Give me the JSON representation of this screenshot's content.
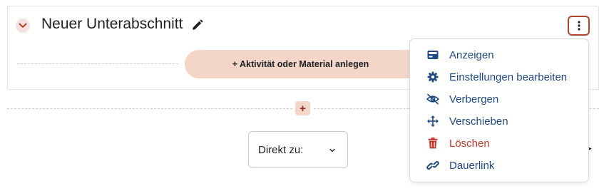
{
  "section": {
    "title": "Neuer Unterabschnitt",
    "add_activity_label": "+ Aktivität oder Material anlegen",
    "add_section_label": "+"
  },
  "jump": {
    "label": "Direkt zu:"
  },
  "menu": {
    "items": [
      {
        "label": "Anzeigen",
        "icon": "show-icon"
      },
      {
        "label": "Einstellungen bearbeiten",
        "icon": "gear-icon"
      },
      {
        "label": "Verbergen",
        "icon": "eye-slash-icon"
      },
      {
        "label": "Verschieben",
        "icon": "move-arrows-icon"
      },
      {
        "label": "Löschen",
        "icon": "trash-icon",
        "danger": true
      },
      {
        "label": "Dauerlink",
        "icon": "link-icon"
      }
    ]
  },
  "colors": {
    "accent": "#b0452d",
    "accent_light": "#f3d6c8",
    "menu_text": "#1f4a80",
    "danger": "#c0392b"
  }
}
